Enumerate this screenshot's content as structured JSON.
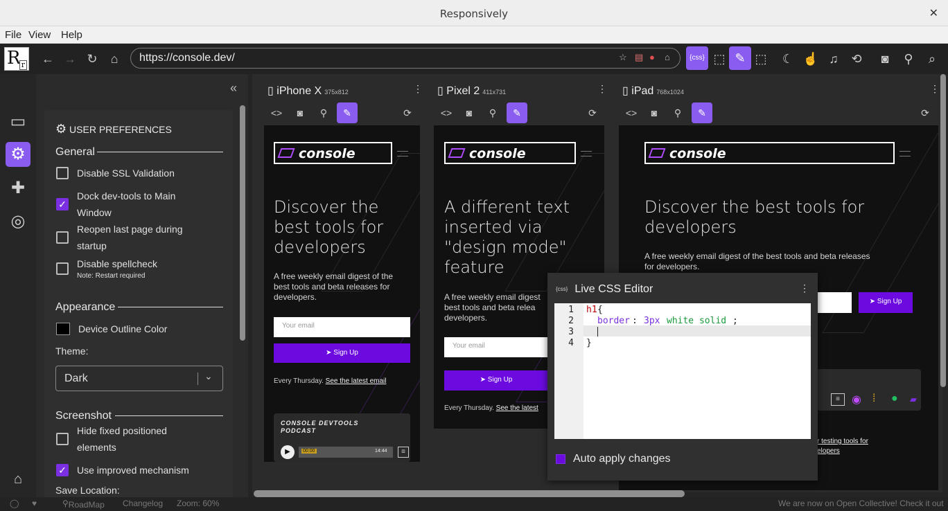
{
  "window": {
    "title": "Responsively",
    "close": "✕"
  },
  "menu": [
    "File",
    "View",
    "Help"
  ],
  "toolbar": {
    "logo_main": "R",
    "logo_small": "r",
    "url": "https://console.dev/",
    "icons": [
      "back-icon",
      "forward-icon",
      "reload-icon",
      "home-icon",
      "star-icon",
      "clear-storage-icon",
      "delete-cookies-icon",
      "bookmark-icon",
      "css-editor-icon",
      "inspect-icon",
      "design-mode-icon",
      "screenshot-region-icon",
      "dark-mode-icon",
      "touch-icon",
      "mute-icon",
      "rotate-icon",
      "screenshot-icon",
      "hide-devtools-icon",
      "zoom-icon"
    ],
    "css_label": "{css}"
  },
  "leftbar": {
    "icons": [
      "devices-icon",
      "settings-icon",
      "extensions-icon",
      "network-icon",
      "gift-icon"
    ]
  },
  "prefs": {
    "title": "USER PREFERENCES",
    "general": "General",
    "disable_ssl": "Disable SSL Validation",
    "dock_devtools_1": "Dock dev-tools to Main",
    "dock_devtools_2": "Window",
    "reopen_1": "Reopen last page during",
    "reopen_2": "startup",
    "disable_spell": "Disable spellcheck",
    "spell_note": "Note: Restart required",
    "appearance": "Appearance",
    "outline_color": "Device Outline Color",
    "theme_label": "Theme:",
    "theme_value": "Dark",
    "screenshot": "Screenshot",
    "hide_fixed_1": "Hide fixed positioned",
    "hide_fixed_2": "elements",
    "improved": "Use improved mechanism",
    "save_location": "Save Location:",
    "checks": {
      "ssl": false,
      "dock": true,
      "reopen": false,
      "spell": false,
      "hide_fixed": false,
      "improved": true
    }
  },
  "devices": [
    {
      "name": "iPhone X",
      "size": "375x812"
    },
    {
      "name": "Pixel 2",
      "size": "411x731"
    },
    {
      "name": "iPad",
      "size": "768x1024"
    }
  ],
  "site": {
    "logo": "console",
    "hero_default": "Discover the best tools for developers",
    "hero_l1": "Discover the",
    "hero_l2": "best tools for",
    "hero_l3": "developers",
    "hero_p1": "A different text",
    "hero_p2": "inserted via",
    "hero_p3": "\"design mode\"",
    "hero_p4": "feature",
    "ipad_h1": "Discover the best tools for",
    "ipad_h2": "developers",
    "sub_i1": "A free weekly email digest of the",
    "sub_i2": "best tools and beta releases for",
    "sub_i3": "developers.",
    "sub_p1": "A free weekly email digest",
    "sub_p2": "best tools and beta relea",
    "sub_p3": "developers.",
    "ipad_sub1": "A free weekly email digest of the best tools and beta releases",
    "ipad_sub2": "for developers.",
    "email_placeholder": "Your email",
    "signup": "Sign Up",
    "every_thursday": "Every Thursday.",
    "see_latest": "See the latest email",
    "see_latest_cut": "See the latest",
    "podcast_1": "CONSOLE DEVTOOLS",
    "podcast_2": "PODCAST",
    "time_start": "00:00",
    "time_end": "14:44",
    "ipad_link1": "r testing tools for",
    "ipad_link2": "elopers"
  },
  "css_editor": {
    "badge": "{css}",
    "title": "Live CSS Editor",
    "lines": [
      "1",
      "2",
      "3",
      "4"
    ],
    "code_selector": "h1",
    "code_brace_open": "{",
    "code_prop": "border",
    "code_colon": ":",
    "code_value_num": "3px",
    "code_value_rest": "white solid",
    "code_semi": ";",
    "code_brace_close": "}",
    "auto_apply": "Auto apply changes"
  },
  "statusbar": {
    "roadmap": "RoadMap",
    "changelog": "Changelog",
    "zoom": "Zoom: 60%",
    "opencollective": "We are now on Open Collective! Check it out"
  }
}
